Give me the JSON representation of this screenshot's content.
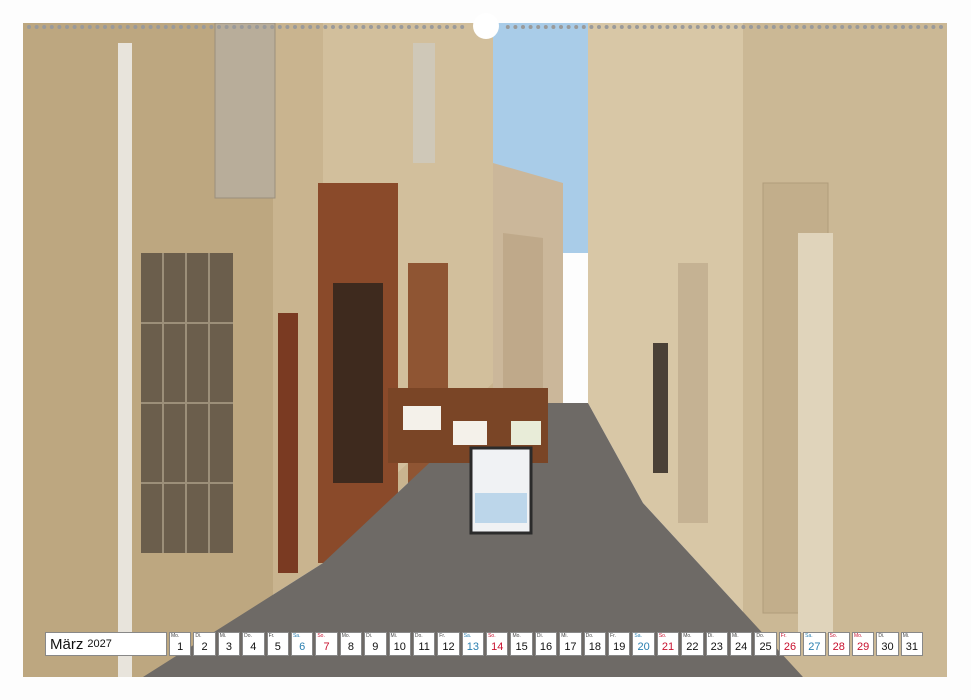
{
  "calendar": {
    "month": "März",
    "year": "2027",
    "days": [
      {
        "wd": "Mo.",
        "d": "1",
        "type": "weekday"
      },
      {
        "wd": "Di.",
        "d": "2",
        "type": "weekday"
      },
      {
        "wd": "Mi.",
        "d": "3",
        "type": "weekday"
      },
      {
        "wd": "Do.",
        "d": "4",
        "type": "weekday"
      },
      {
        "wd": "Fr.",
        "d": "5",
        "type": "weekday"
      },
      {
        "wd": "Sa.",
        "d": "6",
        "type": "sat"
      },
      {
        "wd": "So.",
        "d": "7",
        "type": "sun"
      },
      {
        "wd": "Mo.",
        "d": "8",
        "type": "weekday"
      },
      {
        "wd": "Di.",
        "d": "9",
        "type": "weekday"
      },
      {
        "wd": "Mi.",
        "d": "10",
        "type": "weekday"
      },
      {
        "wd": "Do.",
        "d": "11",
        "type": "weekday"
      },
      {
        "wd": "Fr.",
        "d": "12",
        "type": "weekday"
      },
      {
        "wd": "Sa.",
        "d": "13",
        "type": "sat"
      },
      {
        "wd": "So.",
        "d": "14",
        "type": "sun"
      },
      {
        "wd": "Mo.",
        "d": "15",
        "type": "weekday"
      },
      {
        "wd": "Di.",
        "d": "16",
        "type": "weekday"
      },
      {
        "wd": "Mi.",
        "d": "17",
        "type": "weekday"
      },
      {
        "wd": "Do.",
        "d": "18",
        "type": "weekday"
      },
      {
        "wd": "Fr.",
        "d": "19",
        "type": "weekday"
      },
      {
        "wd": "Sa.",
        "d": "20",
        "type": "sat"
      },
      {
        "wd": "So.",
        "d": "21",
        "type": "sun"
      },
      {
        "wd": "Mo.",
        "d": "22",
        "type": "weekday"
      },
      {
        "wd": "Di.",
        "d": "23",
        "type": "weekday"
      },
      {
        "wd": "Mi.",
        "d": "24",
        "type": "weekday"
      },
      {
        "wd": "Do.",
        "d": "25",
        "type": "weekday"
      },
      {
        "wd": "Fr.",
        "d": "26",
        "type": "sun"
      },
      {
        "wd": "Sa.",
        "d": "27",
        "type": "sat"
      },
      {
        "wd": "So.",
        "d": "28",
        "type": "sun"
      },
      {
        "wd": "Mo.",
        "d": "29",
        "type": "sun"
      },
      {
        "wd": "Di.",
        "d": "30",
        "type": "weekday"
      },
      {
        "wd": "Mi.",
        "d": "31",
        "type": "weekday"
      }
    ]
  },
  "colors": {
    "sky": "#a9cce8",
    "left_wall": "#c9b48f",
    "right_wall": "#d8c7a6",
    "cobble": "#6e6a66",
    "shop_wood": "#8a4a2a",
    "sat": "#2a7fb0",
    "sun": "#c8102e"
  }
}
